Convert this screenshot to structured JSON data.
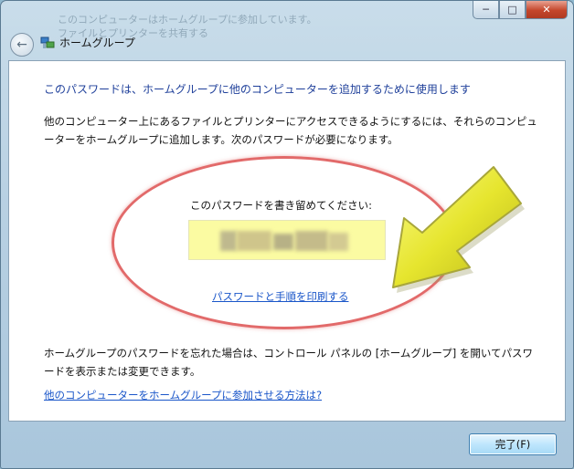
{
  "window": {
    "title": "ホームグループ",
    "ghost_line_1": "このコンピューターはホームグループに参加しています。",
    "ghost_line_2": "ファイルとプリンターを共有する"
  },
  "caption_buttons": {
    "minimize": "─",
    "maximize": "□",
    "close": "✕"
  },
  "content": {
    "heading": "このパスワードは、ホームグループに他のコンピューターを追加するために使用します",
    "description": "他のコンピューター上にあるファイルとプリンターにアクセスできるようにするには、それらのコンピューターをホームグループに追加します。次のパスワードが必要になります。",
    "password_label": "このパスワードを書き留めてください:",
    "print_link": "パスワードと手順を印刷する",
    "forgot_text": "ホームグループのパスワードを忘れた場合は、コントロール パネルの [ホームグループ] を開いてパスワードを表示または変更できます。",
    "help_link": "他のコンピューターをホームグループに参加させる方法は?"
  },
  "footer": {
    "finish_button": "完了(F)"
  },
  "colors": {
    "heading": "#1e3f9a",
    "link": "#1a56c9",
    "highlight_oval": "#e26a6a",
    "password_box": "#fbfba2",
    "arrow": "#e9e83a"
  },
  "icons": [
    "back-arrow-icon",
    "homegroup-icon",
    "minimize-icon",
    "maximize-icon",
    "close-icon"
  ]
}
